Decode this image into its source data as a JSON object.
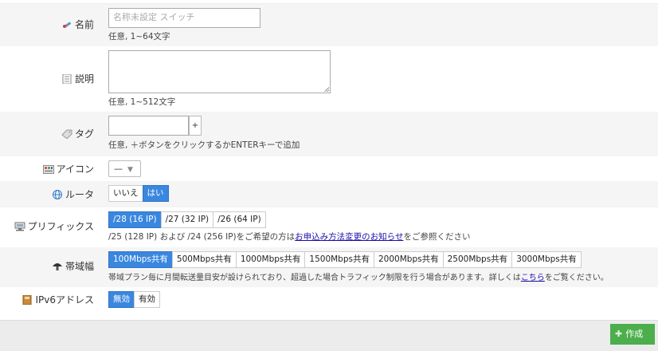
{
  "fields": {
    "name": {
      "label": "名前",
      "placeholder": "名称未設定 スイッチ",
      "help": "任意, 1~64文字",
      "icon": "pencil-icon"
    },
    "description": {
      "label": "説明",
      "help": "任意, 1~512文字",
      "icon": "document-icon"
    },
    "tags": {
      "label": "タグ",
      "plus": "+",
      "help": "任意, ＋ボタンをクリックするかENTERキーで追加",
      "icon": "tag-icon"
    },
    "icon": {
      "label": "アイコン",
      "value": "—",
      "icon": "image-icon"
    },
    "router": {
      "label": "ルータ",
      "options": [
        "いいえ",
        "はい"
      ],
      "selected": "はい",
      "icon": "globe-icon"
    },
    "prefix": {
      "label": "プリフィックス",
      "options": [
        "/28 (16 IP)",
        "/27 (32 IP)",
        "/26 (64 IP)"
      ],
      "selected": "/28 (16 IP)",
      "help_before": "/25 (128 IP) および /24 (256 IP)をご希望の方は",
      "help_link": "お申込み方法変更のお知らせ",
      "help_after": "をご参照ください",
      "icon": "network-icon"
    },
    "bandwidth": {
      "label": "帯域幅",
      "options": [
        "100Mbps共有",
        "500Mbps共有",
        "1000Mbps共有",
        "1500Mbps共有",
        "2000Mbps共有",
        "2500Mbps共有",
        "3000Mbps共有"
      ],
      "selected": "100Mbps共有",
      "help_before": "帯域プラン毎に月間転送量目安が設けられており、超過した場合トラフィック制限を行う場合があります。詳しくは",
      "help_link": "こちら",
      "help_after": "をご覧ください。",
      "icon": "mushroom-icon"
    },
    "ipv6": {
      "label": "IPv6アドレス",
      "options": [
        "無効",
        "有効"
      ],
      "selected": "無効",
      "icon": "book-icon"
    }
  },
  "footer": {
    "create_label": "作成",
    "create_icon": "plus-icon"
  },
  "colors": {
    "accent": "#3a87e0",
    "create": "#4cae4c",
    "alt_row": "#f5f5f5"
  }
}
